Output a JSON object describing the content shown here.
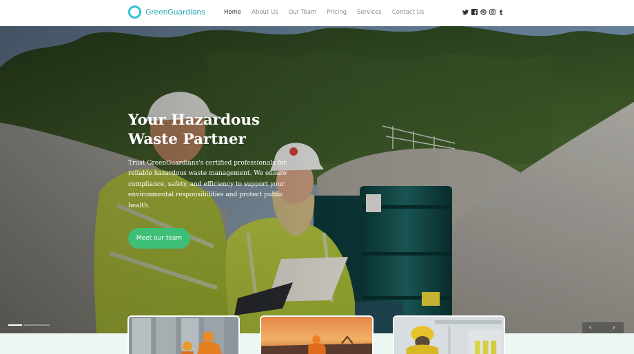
{
  "brand": {
    "name": "GreenGuardians",
    "ring_color": "#2fc1d6",
    "text_color": "#27a7b5"
  },
  "nav": {
    "items": [
      {
        "label": "Home",
        "active": true
      },
      {
        "label": "About Us",
        "active": false
      },
      {
        "label": "Our Team",
        "active": false
      },
      {
        "label": "Pricing",
        "active": false
      },
      {
        "label": "Services",
        "active": false
      },
      {
        "label": "Contact Us",
        "active": false
      }
    ]
  },
  "social": [
    "twitter-icon",
    "facebook-icon",
    "dribbble-icon",
    "instagram-icon",
    "tumblr-icon"
  ],
  "hero": {
    "title_line1": "Your Hazardous",
    "title_line2": "Waste Partner",
    "description": "Trust GreenGuardians's certified professionals for reliable hazardous waste management. We ensure compliance, safety, and efficiency to support your environmental responsibilities and protect public health.",
    "cta_label": "Meet our team",
    "cta_color": "#3dbf78"
  },
  "slider": {
    "current_slide": 1
  },
  "cards": [
    "industrial-workers-photo",
    "sunset-workers-photo",
    "hazmat-worker-photo"
  ],
  "colors": {
    "strip_bg": "#ecf7f3"
  }
}
